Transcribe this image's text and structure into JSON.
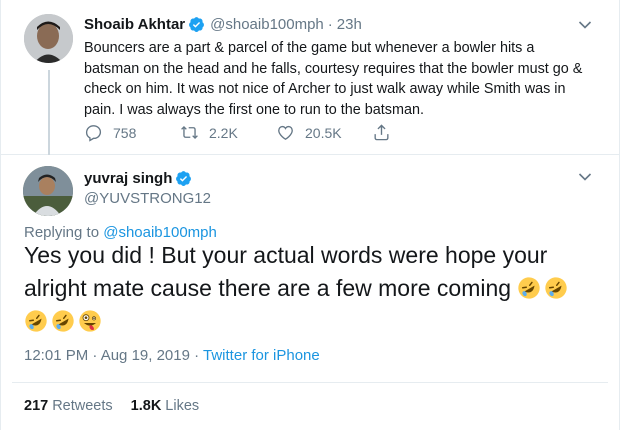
{
  "parent_tweet": {
    "name": "Shoaib Akhtar",
    "handle": "@shoaib100mph",
    "separator": "·",
    "time": "23h",
    "text": "Bouncers are a part & parcel of the game but whenever a bowler hits a batsman on the head and he falls, courtesy requires that the bowler must go & check on him. It was not nice of Archer to just walk away while Smith was in pain. I was always the first one to run to the batsman.",
    "replies": "758",
    "retweets": "2.2K",
    "likes": "20.5K"
  },
  "main_tweet": {
    "name": "yuvraj singh",
    "handle": "@YUVSTRONG12",
    "replying_prefix": "Replying to ",
    "replying_to": "@shoaib100mph",
    "text": "Yes you did ! But your actual words were hope your alright mate cause there are a few more coming",
    "emojis": [
      "rolling-on-floor-laughing",
      "rolling-on-floor-laughing",
      "rolling-on-floor-laughing",
      "rolling-on-floor-laughing",
      "zany-face"
    ],
    "timestamp": "12:01 PM · Aug 19, 2019 · ",
    "source": "Twitter for iPhone",
    "retweet_count": "217",
    "retweet_label": "Retweets",
    "like_count": "1.8K",
    "like_label": "Likes"
  },
  "colors": {
    "verified": "#1da1f2",
    "link": "#1b95e0",
    "secondary_text": "#657786",
    "border": "#e6ecf0"
  }
}
